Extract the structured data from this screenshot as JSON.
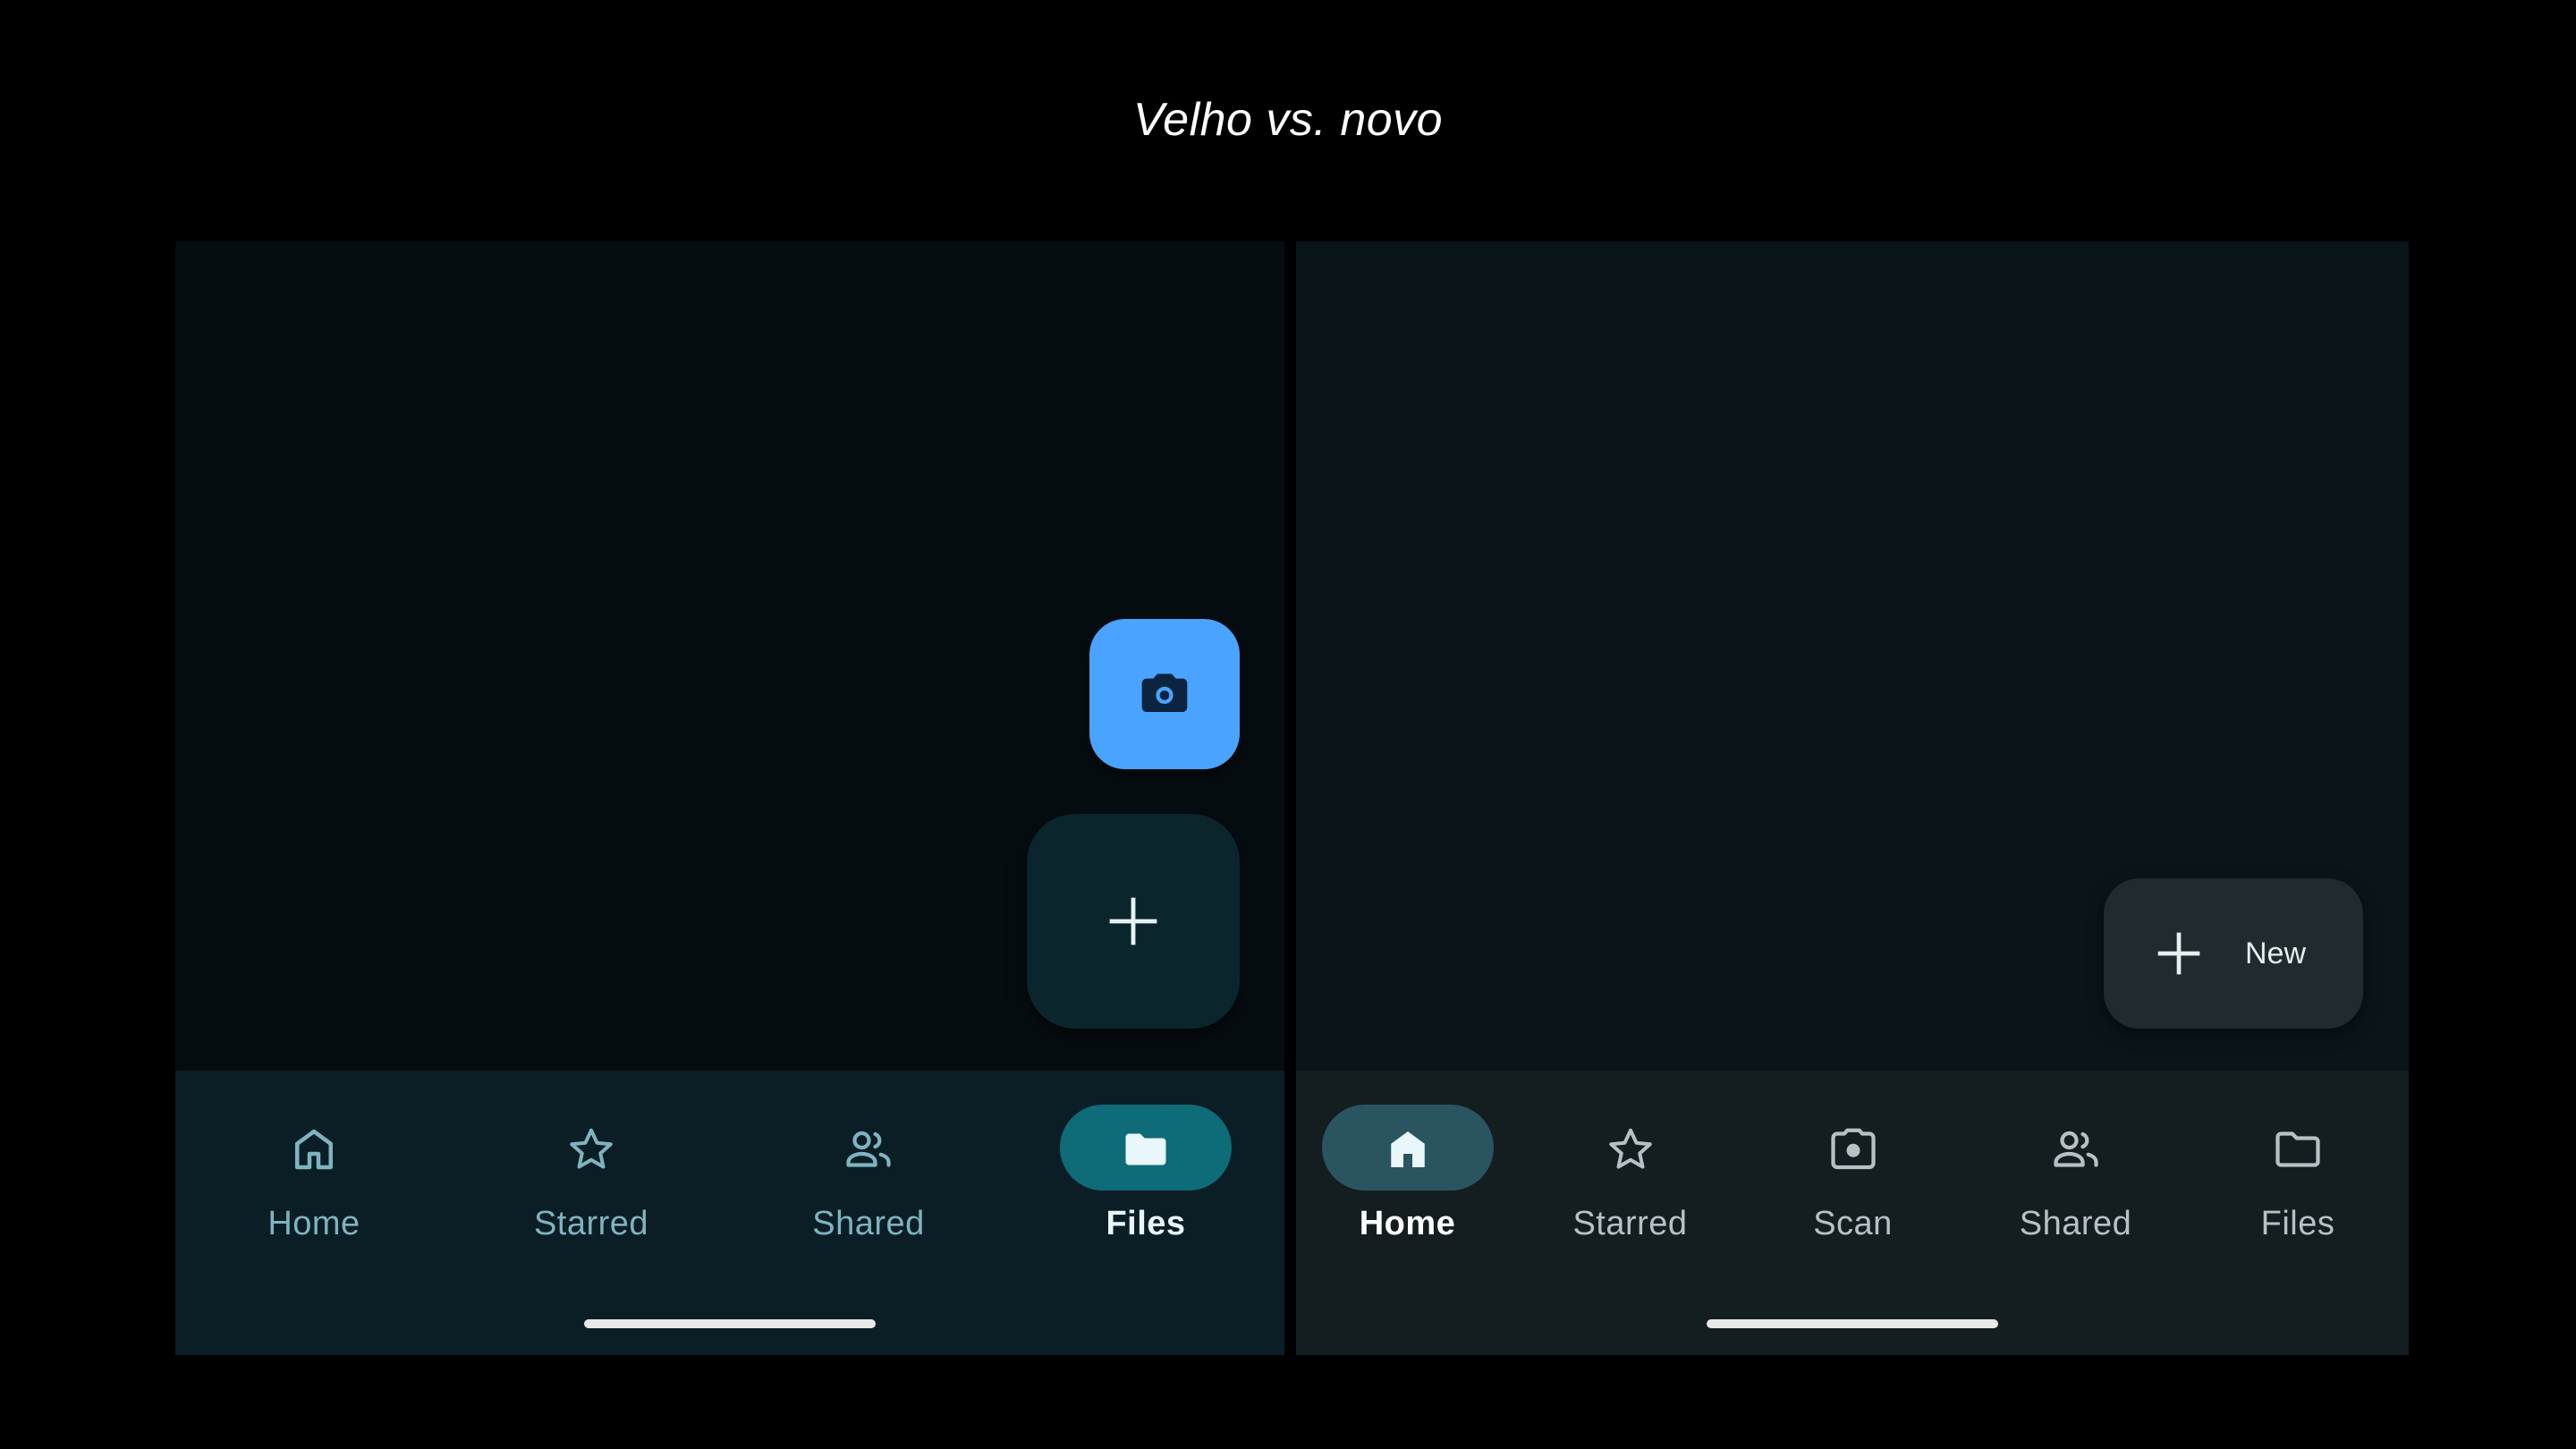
{
  "title": "Velho vs. novo",
  "old": {
    "nav": [
      {
        "label": "Home",
        "icon": "home-icon",
        "active": false
      },
      {
        "label": "Starred",
        "icon": "star-icon",
        "active": false
      },
      {
        "label": "Shared",
        "icon": "people-icon",
        "active": false
      },
      {
        "label": "Files",
        "icon": "folder-icon",
        "active": true
      }
    ],
    "fabs": {
      "camera_icon": "camera-icon",
      "plus_icon": "plus-icon"
    },
    "colors": {
      "accent": "#4aa3ff",
      "active_pill": "#0e6b78"
    }
  },
  "new": {
    "nav": [
      {
        "label": "Home",
        "icon": "home-icon",
        "active": true
      },
      {
        "label": "Starred",
        "icon": "star-icon",
        "active": false
      },
      {
        "label": "Scan",
        "icon": "scan-icon",
        "active": false
      },
      {
        "label": "Shared",
        "icon": "people-icon",
        "active": false
      },
      {
        "label": "Files",
        "icon": "folder-icon",
        "active": false
      }
    ],
    "fab": {
      "label": "New",
      "icon": "plus-icon"
    },
    "colors": {
      "active_pill": "#2a5560"
    }
  }
}
